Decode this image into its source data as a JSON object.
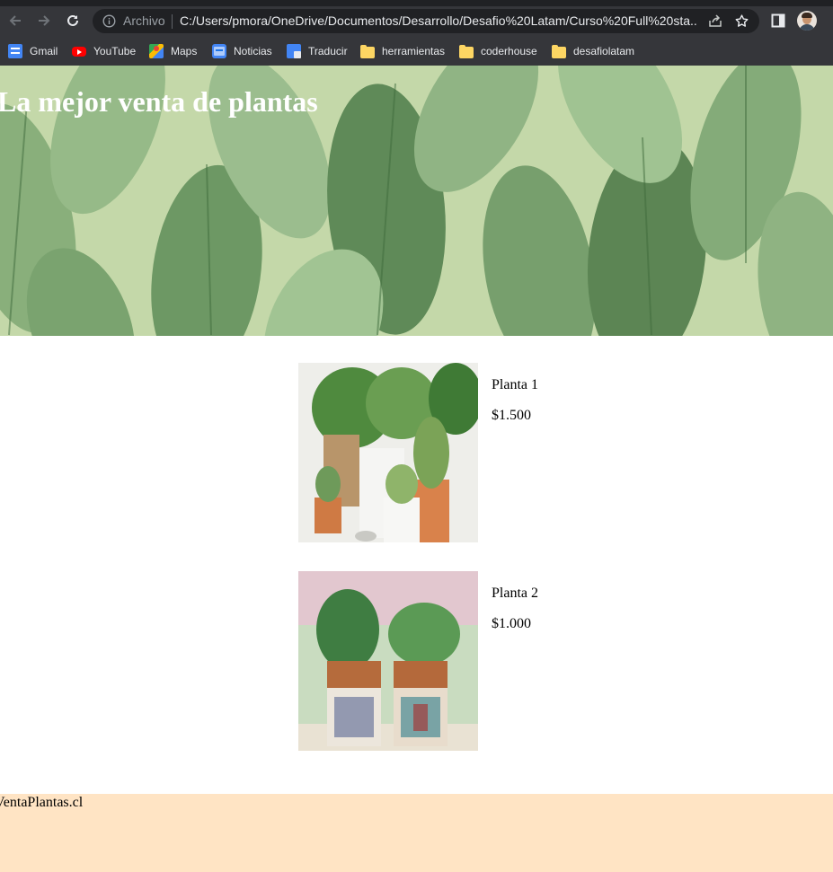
{
  "browser": {
    "scheme_label": "Archivo",
    "url": "C:/Users/pmora/OneDrive/Documentos/Desarrollo/Desafio%20Latam/Curso%20Full%20sta...",
    "bookmarks": [
      {
        "label": "Gmail",
        "icon": "gmail-icon"
      },
      {
        "label": "YouTube",
        "icon": "youtube-icon"
      },
      {
        "label": "Maps",
        "icon": "maps-icon"
      },
      {
        "label": "Noticias",
        "icon": "news-icon"
      },
      {
        "label": "Traducir",
        "icon": "translate-icon"
      },
      {
        "label": "herramientas",
        "icon": "folder-icon"
      },
      {
        "label": "coderhouse",
        "icon": "folder-icon"
      },
      {
        "label": "desafiolatam",
        "icon": "folder-icon"
      }
    ]
  },
  "page": {
    "hero_title": "La mejor venta de plantas",
    "products": [
      {
        "name": "Planta 1",
        "price": "$1.500"
      },
      {
        "name": "Planta 2",
        "price": "$1.000"
      }
    ],
    "footer_text": "VentaPlantas.cl"
  },
  "colors": {
    "hero_background": "#c4d8a9",
    "footer_background": "#ffe4c4"
  }
}
